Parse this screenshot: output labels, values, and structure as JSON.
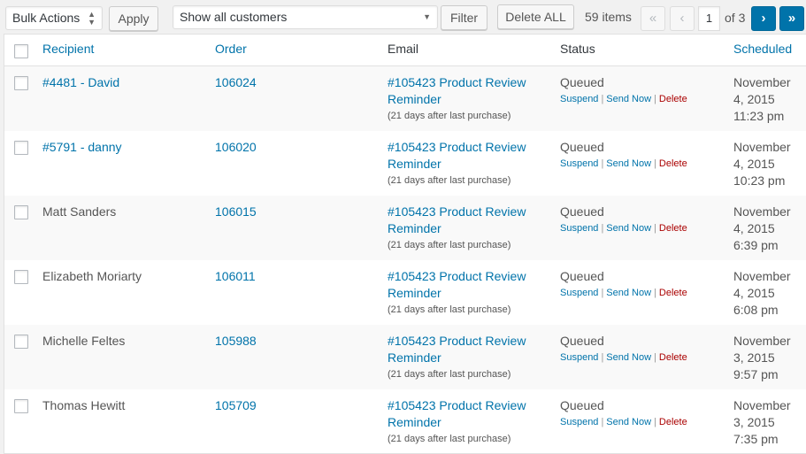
{
  "toolbar": {
    "bulk_actions": "Bulk Actions",
    "apply": "Apply",
    "customer_filter": "Show all customers",
    "filter": "Filter",
    "delete_all": "Delete ALL",
    "items_count": "59 items",
    "first_page": "«",
    "prev_page": "‹",
    "current_page": "1",
    "of_pages": "of 3",
    "next_page": "›",
    "last_page": "»"
  },
  "columns": {
    "recipient": "Recipient",
    "order": "Order",
    "email": "Email",
    "status": "Status",
    "scheduled": "Scheduled"
  },
  "rows": [
    {
      "recipient": "#4481 - David",
      "recipient_link": true,
      "order": "106024",
      "email_title": "#105423 Product Review Reminder",
      "email_note": "(21 days after last purchase)",
      "status": "Queued",
      "suspend": "Suspend",
      "send_now": "Send Now",
      "delete": "Delete",
      "scheduled": "November 4, 2015 11:23 pm"
    },
    {
      "recipient": "#5791 - danny",
      "recipient_link": true,
      "order": "106020",
      "email_title": "#105423 Product Review Reminder",
      "email_note": "(21 days after last purchase)",
      "status": "Queued",
      "suspend": "Suspend",
      "send_now": "Send Now",
      "delete": "Delete",
      "scheduled": "November 4, 2015 10:23 pm"
    },
    {
      "recipient": "Matt Sanders",
      "recipient_link": false,
      "order": "106015",
      "email_title": "#105423 Product Review Reminder",
      "email_note": "(21 days after last purchase)",
      "status": "Queued",
      "suspend": "Suspend",
      "send_now": "Send Now",
      "delete": "Delete",
      "scheduled": "November 4, 2015 6:39 pm"
    },
    {
      "recipient": "Elizabeth Moriarty",
      "recipient_link": false,
      "order": "106011",
      "email_title": "#105423 Product Review Reminder",
      "email_note": "(21 days after last purchase)",
      "status": "Queued",
      "suspend": "Suspend",
      "send_now": "Send Now",
      "delete": "Delete",
      "scheduled": "November 4, 2015 6:08 pm"
    },
    {
      "recipient": "Michelle Feltes",
      "recipient_link": false,
      "order": "105988",
      "email_title": "#105423 Product Review Reminder",
      "email_note": "(21 days after last purchase)",
      "status": "Queued",
      "suspend": "Suspend",
      "send_now": "Send Now",
      "delete": "Delete",
      "scheduled": "November 3, 2015 9:57 pm"
    },
    {
      "recipient": "Thomas Hewitt",
      "recipient_link": false,
      "order": "105709",
      "email_title": "#105423 Product Review Reminder",
      "email_note": "(21 days after last purchase)",
      "status": "Queued",
      "suspend": "Suspend",
      "send_now": "Send Now",
      "delete": "Delete",
      "scheduled": "November 3, 2015 7:35 pm"
    }
  ],
  "colors": {
    "link": "#0073aa",
    "delete": "#a00000",
    "active_page": "#0073aa"
  }
}
